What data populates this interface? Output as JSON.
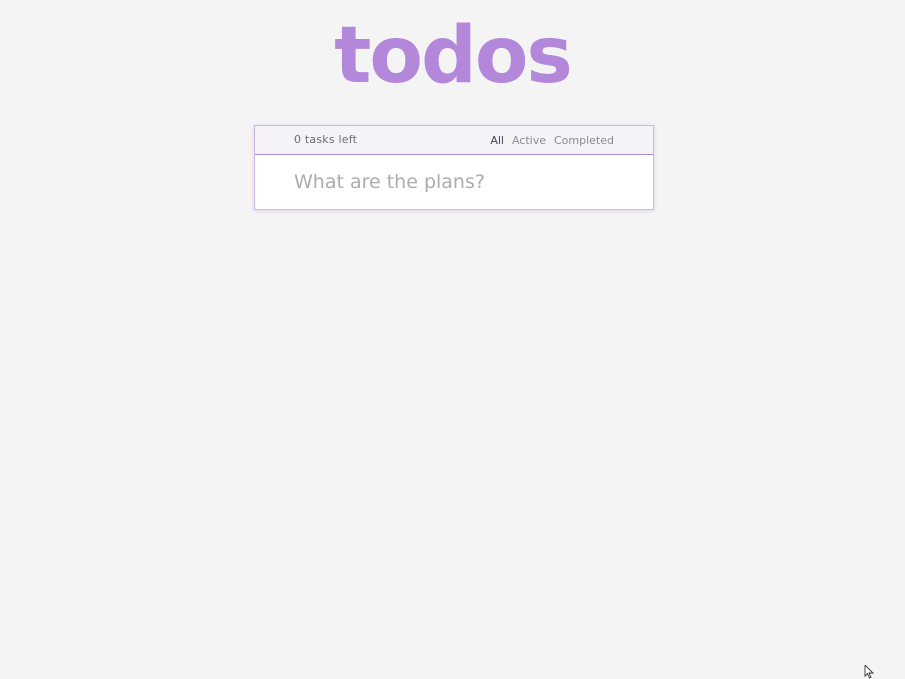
{
  "header": {
    "title": "todos"
  },
  "todo_card": {
    "tasks_left": "0 tasks left",
    "filters": [
      {
        "label": "All",
        "selected": true
      },
      {
        "label": "Active",
        "selected": false
      },
      {
        "label": "Completed",
        "selected": false
      }
    ],
    "new_todo": {
      "value": "",
      "placeholder": "What are the plans?"
    }
  },
  "colors": {
    "brand": "#b388db",
    "background": "#f4f4f5",
    "card_border": "#cdb6e8",
    "input_border": "#a88bd0"
  },
  "icons": {
    "cursor": "mouse-pointer-icon"
  }
}
